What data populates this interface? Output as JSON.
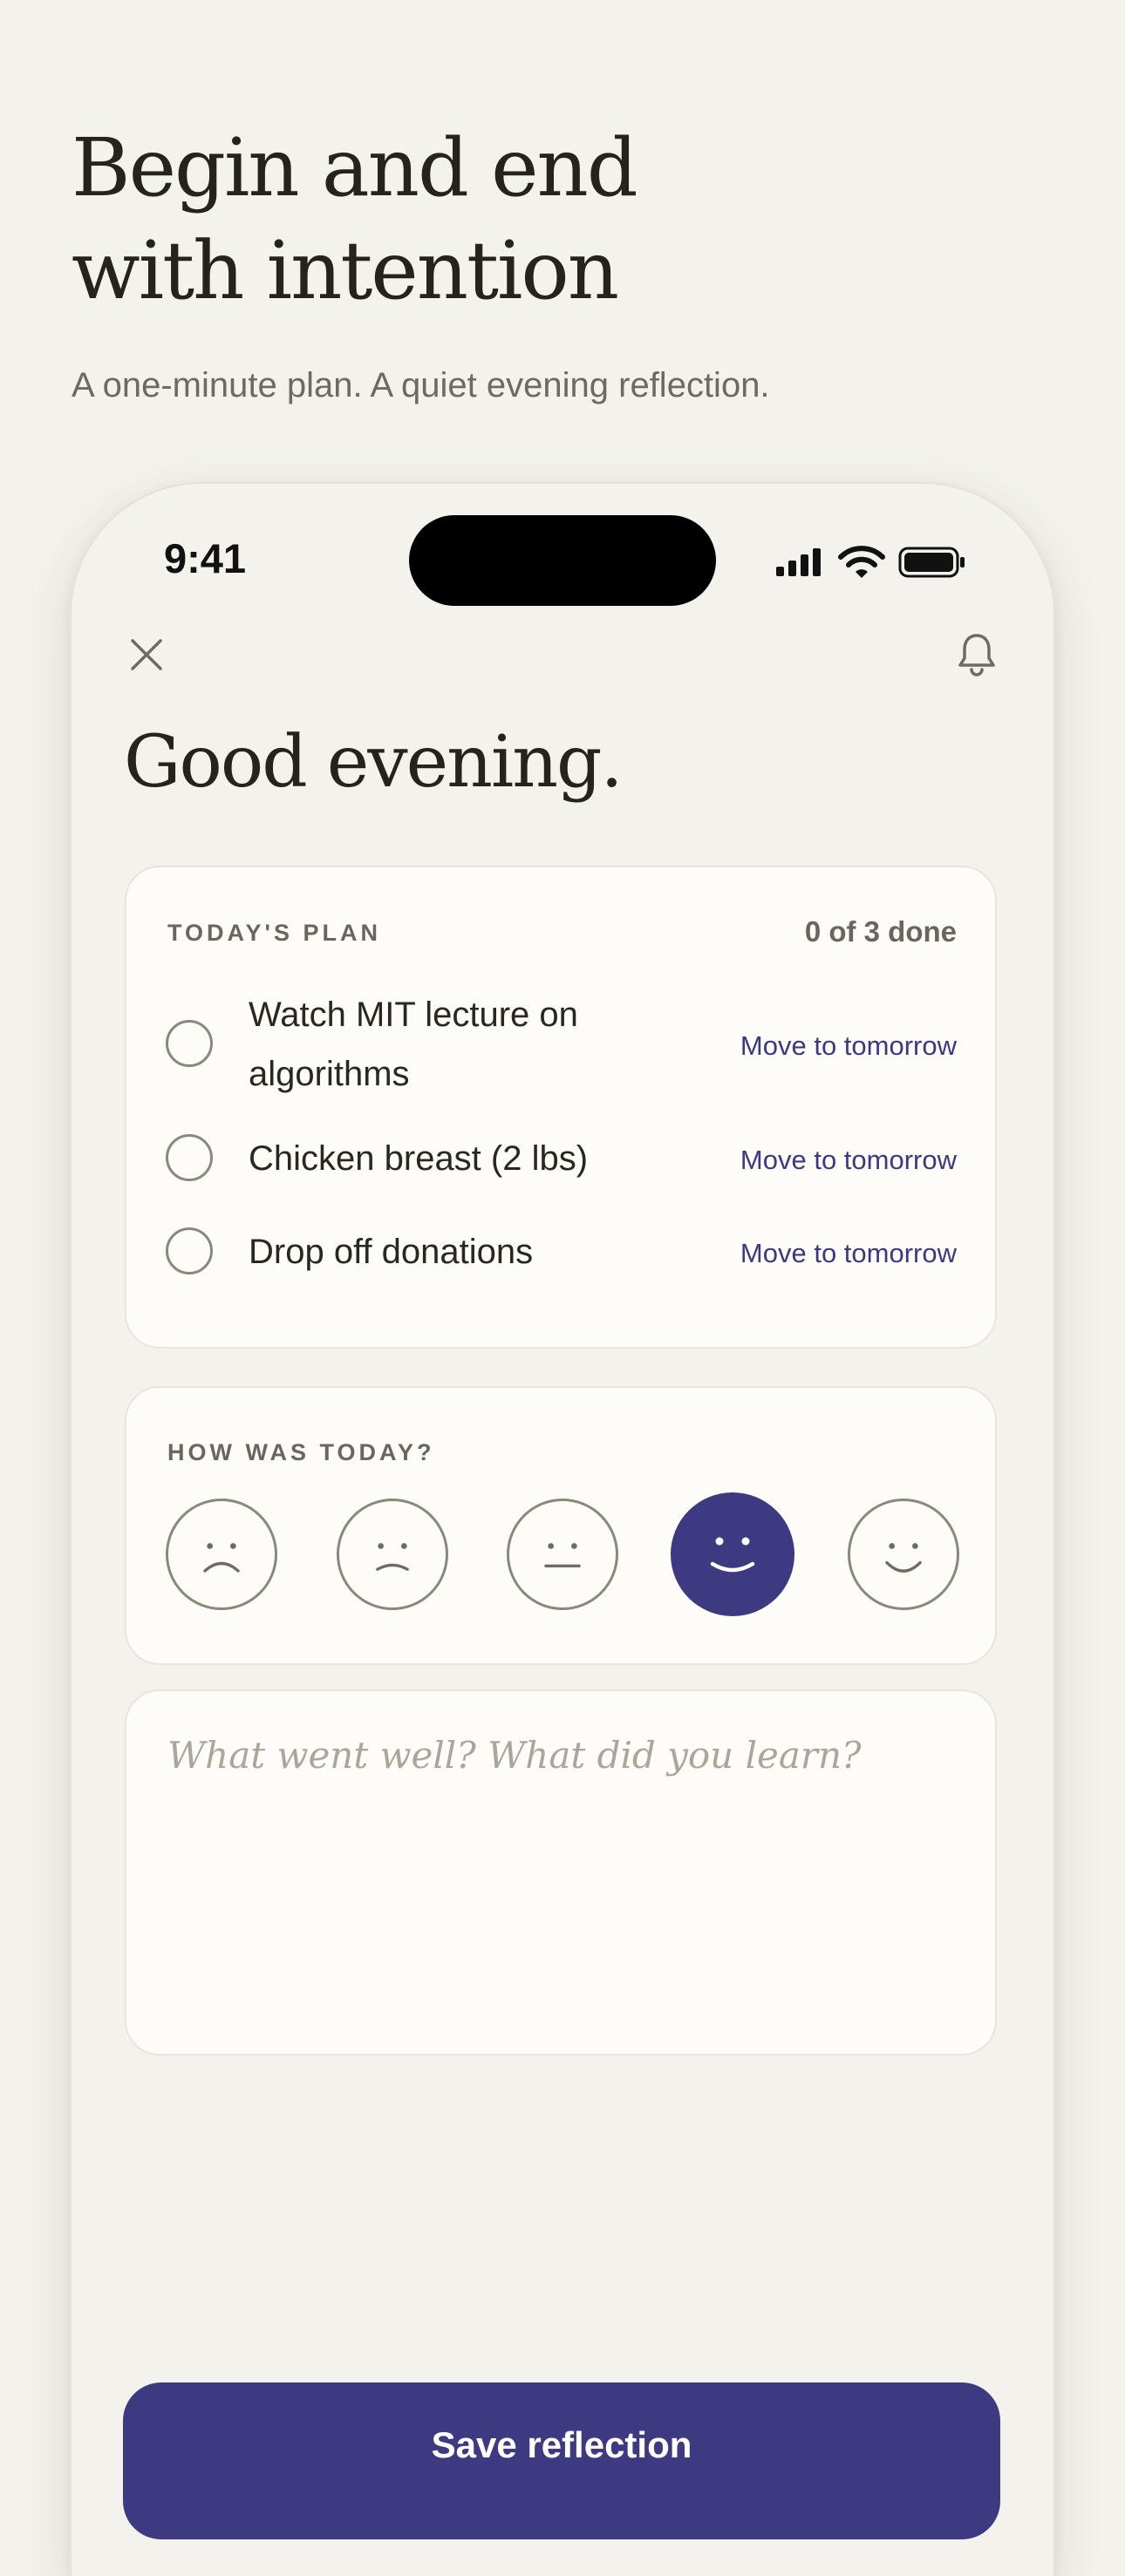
{
  "hero": {
    "title_line1": "Begin and end",
    "title_line2": "with intention",
    "subtitle": "A one-minute plan. A quiet evening reflection."
  },
  "status_bar": {
    "time": "9:41",
    "icons": [
      "cellular-signal-icon",
      "wifi-icon",
      "battery-icon"
    ]
  },
  "top_bar": {
    "close_icon": "close-icon",
    "bell_icon": "bell-icon"
  },
  "greeting": "Good evening.",
  "plan": {
    "label": "TODAY'S PLAN",
    "count": "0 of 3 done",
    "tasks": [
      {
        "title": "Watch MIT lecture on algorithms",
        "done": false,
        "action": "Move to tomorrow"
      },
      {
        "title": "Chicken breast (2 lbs)",
        "done": false,
        "action": "Move to tomorrow"
      },
      {
        "title": "Drop off donations",
        "done": false,
        "action": "Move to tomorrow"
      }
    ]
  },
  "mood": {
    "label": "HOW WAS TODAY?",
    "options": [
      "very-sad-face-icon",
      "sad-face-icon",
      "neutral-face-icon",
      "happy-face-icon",
      "very-happy-face-icon"
    ],
    "selected_index": 3
  },
  "reflection": {
    "placeholder": "What went well? What did you learn?"
  },
  "save_button": {
    "label": "Save reflection"
  },
  "colors": {
    "background": "#f4f2ec",
    "card": "#fdfcf8",
    "accent": "#3d3a82",
    "text": "#2a2722",
    "muted": "#6a665e",
    "placeholder": "#aaa69b"
  }
}
